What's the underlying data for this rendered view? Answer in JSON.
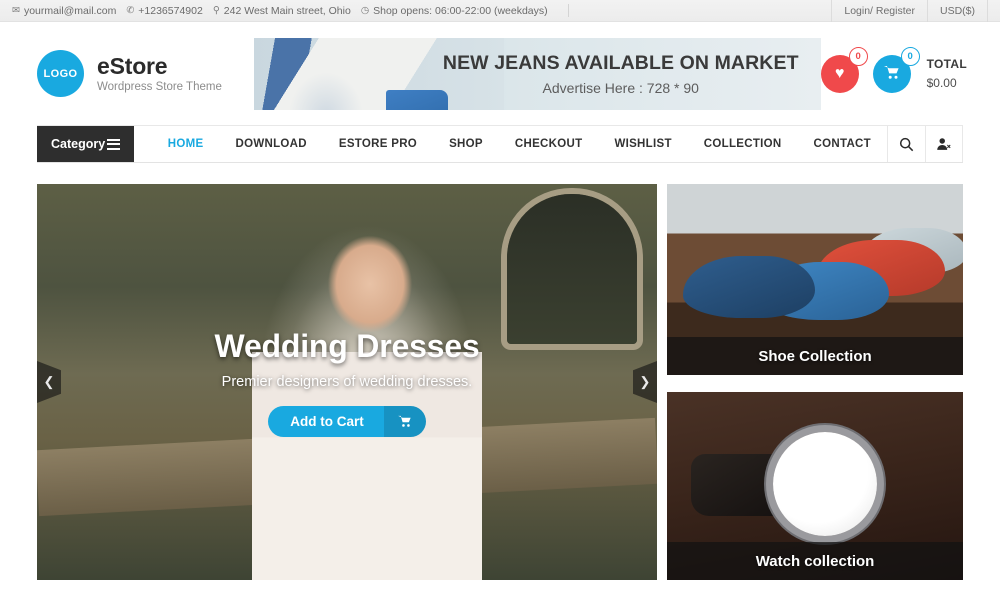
{
  "topbar": {
    "email": "yourmail@mail.com",
    "phone": "+1236574902",
    "address": "242 West Main street, Ohio",
    "hours": "Shop opens: 06:00-22:00 (weekdays)",
    "login": "Login/ Register",
    "currency": "USD($)",
    "icons": {
      "mail": "✉",
      "phone": "✆",
      "pin": "⚲",
      "clock": "◷"
    }
  },
  "header": {
    "logo_text": "LOGO",
    "brand_name": "eStore",
    "brand_sub": "Wordpress Store Theme",
    "ad": {
      "title": "NEW JEANS AVAILABLE ON MARKET",
      "subtitle": "Advertise Here : 728 * 90"
    },
    "wishlist_count": "0",
    "cart_count": "0",
    "total_label": "TOTAL",
    "total_amount": "$0.00",
    "heart_glyph": "♥",
    "cart_glyph": "🛒"
  },
  "nav": {
    "category_label": "Category",
    "links": [
      {
        "label": "HOME",
        "active": true
      },
      {
        "label": "DOWNLOAD",
        "active": false
      },
      {
        "label": "ESTORE PRO",
        "active": false
      },
      {
        "label": "SHOP",
        "active": false
      },
      {
        "label": "CHECKOUT",
        "active": false
      },
      {
        "label": "WISHLIST",
        "active": false
      },
      {
        "label": "COLLECTION",
        "active": false
      },
      {
        "label": "CONTACT",
        "active": false
      }
    ]
  },
  "slider": {
    "title": "Wedding Dresses",
    "subtitle": "Premier designers of wedding dresses.",
    "button_label": "Add to Cart",
    "button_icon": "🛒",
    "prev_glyph": "❮",
    "next_glyph": "❯"
  },
  "collections": [
    {
      "caption": "Shoe Collection"
    },
    {
      "caption": "Watch collection"
    }
  ],
  "colors": {
    "accent_blue": "#19a9e0",
    "accent_blue_dark": "#1792c2",
    "wishlist_red": "#f0494b",
    "category_dark": "#2e2e2e"
  }
}
